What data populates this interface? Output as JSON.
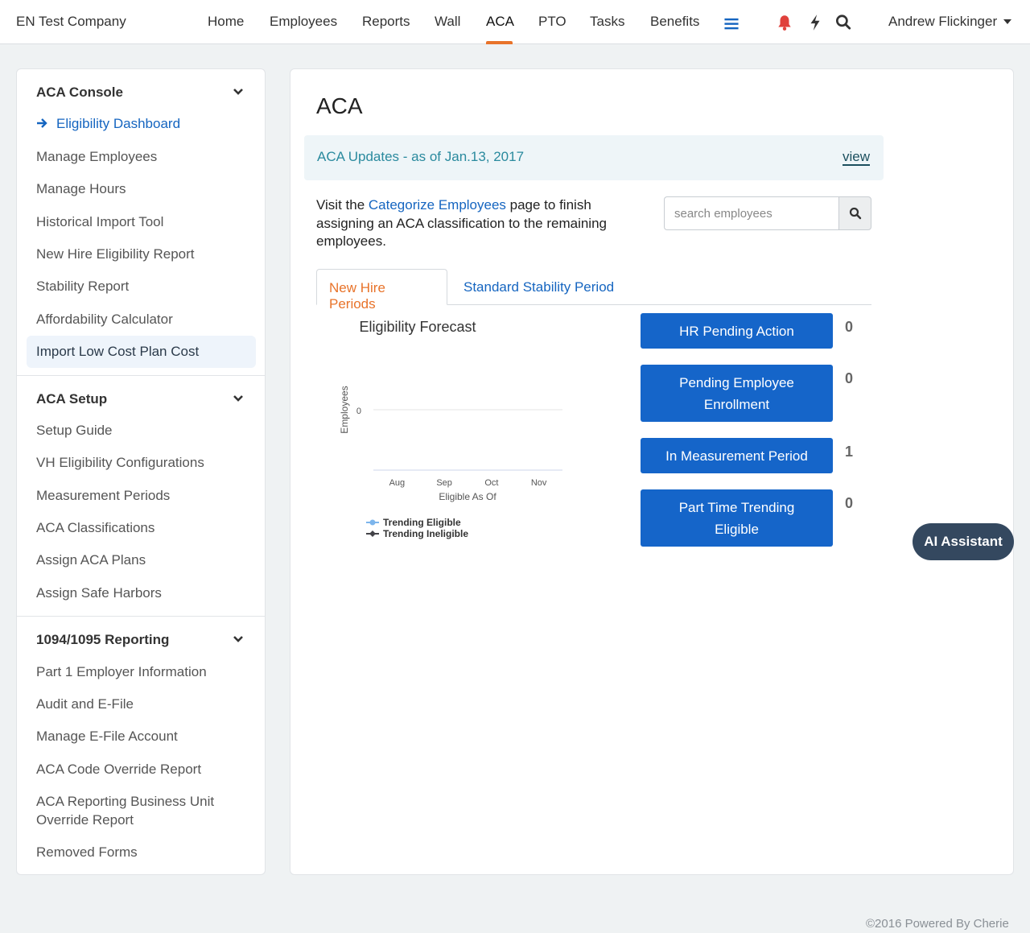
{
  "topbar": {
    "company": "EN Test Company",
    "nav": [
      "Home",
      "Employees",
      "Reports",
      "Wall",
      "ACA",
      "PTO",
      "Tasks",
      "Benefits"
    ],
    "active_nav": "ACA",
    "user": "Andrew Flickinger",
    "icons": [
      "menu-icon",
      "bell-icon",
      "lightning-icon",
      "search-icon"
    ],
    "colors": {
      "accent": "#e8732a",
      "bell": "#e0413c",
      "menu": "#1565c0"
    }
  },
  "sidebar": {
    "sections": [
      {
        "title": "ACA Console",
        "items": [
          "Eligibility Dashboard",
          "Manage Employees",
          "Manage Hours",
          "Historical Import Tool",
          "New Hire Eligibility Report",
          "Stability Report",
          "Affordability Calculator",
          "Import Low Cost Plan Cost"
        ]
      },
      {
        "title": "ACA Setup",
        "items": [
          "Setup Guide",
          "VH Eligibility Configurations",
          "Measurement Periods",
          "ACA Classifications",
          "Assign ACA Plans",
          "Assign Safe Harbors"
        ]
      },
      {
        "title": "1094/1095 Reporting",
        "items": [
          "Part 1 Employer Information",
          "Audit and E-File",
          "Manage E-File Account",
          "ACA Code Override Report",
          "ACA Reporting Business Unit Override Report",
          "Removed Forms"
        ]
      }
    ],
    "current_item": "Eligibility Dashboard",
    "highlighted_item": "Import Low Cost Plan Cost"
  },
  "main": {
    "title": "ACA",
    "banner": {
      "text": "ACA Updates - as of Jan.13, 2017",
      "link": "view"
    },
    "visit": {
      "prefix": "Visit the ",
      "link": "Categorize Employees",
      "suffix": " page to finish assigning an ACA classification to the remaining employees."
    },
    "search": {
      "placeholder": "search employees"
    },
    "tabs": [
      "New Hire Periods",
      "Standard Stability Period"
    ],
    "active_tab": "New Hire Periods",
    "status": [
      {
        "label": "HR Pending Action",
        "count": "0"
      },
      {
        "label": "Pending Employee Enrollment",
        "count": "0"
      },
      {
        "label": "In Measurement Period",
        "count": "1"
      },
      {
        "label": "Part Time Trending Eligible",
        "count": "0"
      }
    ]
  },
  "chart_data": {
    "type": "line",
    "title": "Eligibility Forecast",
    "xlabel": "Eligible As Of",
    "ylabel": "Employees",
    "categories": [
      "Aug",
      "Sep",
      "Oct",
      "Nov"
    ],
    "y_ticks": [
      "0"
    ],
    "series": [
      {
        "name": "Trending Eligible",
        "values": [],
        "color": "#7cb5ec"
      },
      {
        "name": "Trending Ineligible",
        "values": [],
        "color": "#434348"
      }
    ],
    "legend": "bottom-left"
  },
  "ai_button": "AI Assistant",
  "footer": "©2016 Powered By Cherie"
}
